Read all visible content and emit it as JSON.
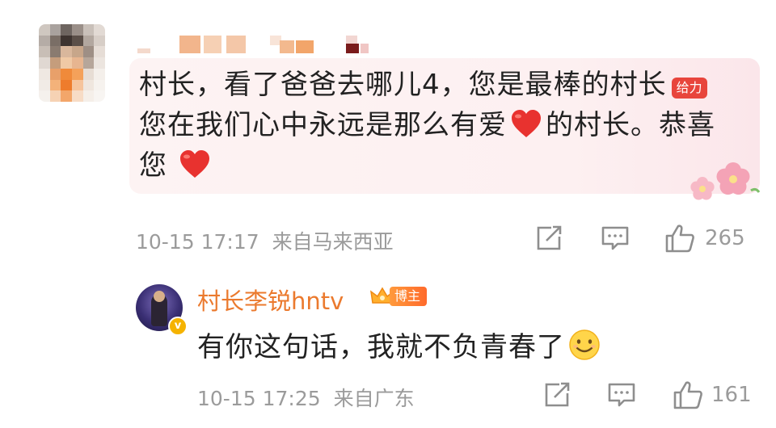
{
  "comment": {
    "line1": "村长，看了爸爸去哪儿4，您是最棒的村长",
    "badge_label": "给力",
    "line2a": "您在我们心中永远是那么有爱",
    "line2b": "的村长。恭喜",
    "line3": "您",
    "heart_icon": "red-heart-emoji",
    "time": "10-15 17:17",
    "source": "来自马来西亚",
    "like_count": "265"
  },
  "reply": {
    "author": "村长李锐hntv",
    "role_badge": "博主",
    "text": "有你这句话，我就不负青春了",
    "emoji": "smile-emoji",
    "time": "10-15 17:25",
    "source": "来自广东",
    "like_count": "161"
  },
  "colors": {
    "author_name": "#eb7a2e",
    "meta_text": "#9b9b9b",
    "bubble_bg": "#fdf2f2",
    "heart": "#e8322f",
    "badge": "#e8453c"
  }
}
